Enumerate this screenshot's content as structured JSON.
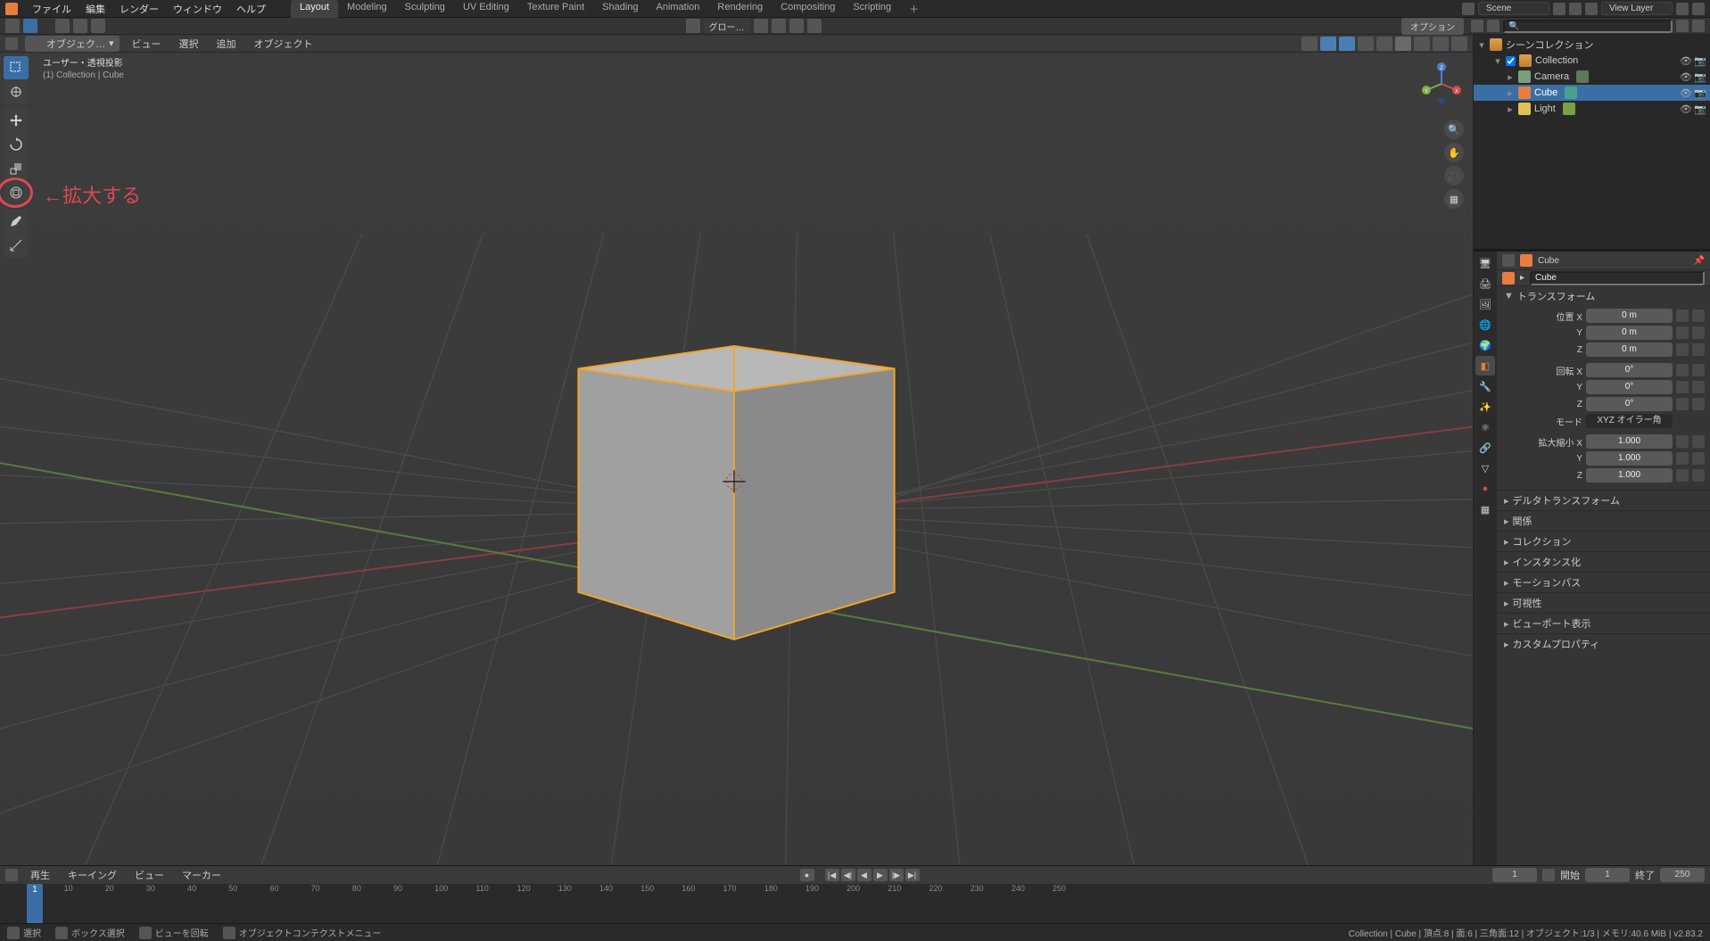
{
  "topmenu": {
    "items": [
      "ファイル",
      "編集",
      "レンダー",
      "ウィンドウ",
      "ヘルプ"
    ]
  },
  "workspaces": {
    "tabs": [
      "Layout",
      "Modeling",
      "Sculpting",
      "UV Editing",
      "Texture Paint",
      "Shading",
      "Animation",
      "Rendering",
      "Compositing",
      "Scripting"
    ],
    "active": 0
  },
  "scene": {
    "label": "Scene"
  },
  "viewlayer": {
    "label": "View Layer"
  },
  "toolbar2": {
    "center_dd": "グロー…",
    "options": "オプション"
  },
  "vpheader": {
    "mode": "オブジェク…",
    "menus": [
      "ビュー",
      "選択",
      "追加",
      "オブジェクト"
    ]
  },
  "vpinfo": {
    "line1": "ユーザー・透視投影",
    "line2": "(1) Collection | Cube"
  },
  "annotation": {
    "text": "←拡大する"
  },
  "outliner": {
    "root": "シーンコレクション",
    "items": [
      {
        "label": "Collection",
        "type": "collection",
        "indent": 1
      },
      {
        "label": "Camera",
        "type": "camera",
        "indent": 2
      },
      {
        "label": "Cube",
        "type": "mesh",
        "indent": 2,
        "selected": true
      },
      {
        "label": "Light",
        "type": "light",
        "indent": 2
      }
    ]
  },
  "properties": {
    "breadcrumb_obj": "Cube",
    "name_field": "Cube",
    "panels": {
      "transform": "トランスフォーム",
      "delta": "デルタトランスフォーム",
      "relations": "関係",
      "collection": "コレクション",
      "instancing": "インスタンス化",
      "motionpaths": "モーションパス",
      "visibility": "可視性",
      "viewport": "ビューポート表示",
      "custom": "カスタムプロパティ"
    },
    "transform": {
      "loc_label": "位置 X",
      "loc_y": "Y",
      "loc_z": "Z",
      "loc_vals": [
        "0 m",
        "0 m",
        "0 m"
      ],
      "rot_label": "回転 X",
      "rot_vals": [
        "0°",
        "0°",
        "0°"
      ],
      "mode_label": "モード",
      "mode_val": "XYZ オイラー角",
      "scale_label": "拡大縮小 X",
      "scale_vals": [
        "1.000",
        "1.000",
        "1.000"
      ]
    }
  },
  "timeline": {
    "menus": [
      "再生",
      "キーイング",
      "ビュー",
      "マーカー"
    ],
    "current_frame": "1",
    "start_label": "開始",
    "start_val": "1",
    "end_label": "終了",
    "end_val": "250",
    "ticks": [
      10,
      20,
      30,
      40,
      50,
      60,
      70,
      80,
      90,
      100,
      110,
      120,
      130,
      140,
      150,
      160,
      170,
      180,
      190,
      200,
      210,
      220,
      230,
      240,
      250
    ]
  },
  "statusbar": {
    "select": "選択",
    "boxselect": "ボックス選択",
    "rotate": "ビューを回転",
    "contextmenu": "オブジェクトコンテクストメニュー",
    "right": "Collection | Cube | 頂点:8 | 面:6 | 三角面:12 | オブジェクト:1/3 | メモリ:40.6 MiB | v2.83.2"
  }
}
